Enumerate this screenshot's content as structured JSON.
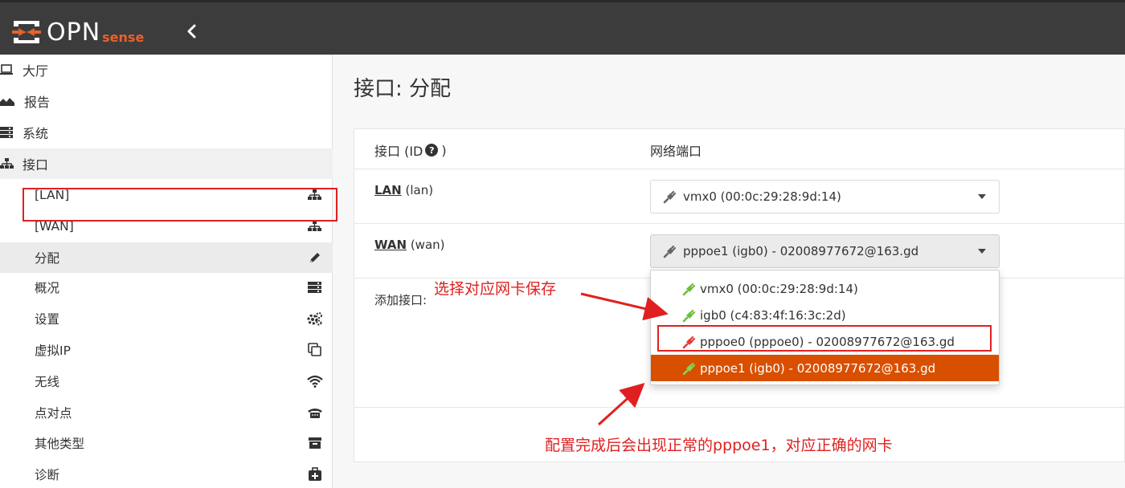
{
  "header": {
    "brand": "OPN",
    "brand_suffix": "sense",
    "collapse_icon": "chevron-left-icon"
  },
  "sidebar": {
    "top_items": [
      {
        "label": "大厅",
        "icon": "laptop-icon"
      },
      {
        "label": "报告",
        "icon": "area-chart-icon"
      },
      {
        "label": "系统",
        "icon": "server-icon"
      },
      {
        "label": "接口",
        "icon": "sitemap-icon"
      }
    ],
    "interface_items": [
      {
        "label": "[LAN]",
        "icon": "sitemap-icon"
      },
      {
        "label": "[WAN]",
        "icon": "sitemap-icon"
      },
      {
        "label": "分配",
        "icon": "pencil-icon",
        "active": true
      },
      {
        "label": "概况",
        "icon": "server-icon"
      },
      {
        "label": "设置",
        "icon": "cogs-icon"
      },
      {
        "label": "虚拟IP",
        "icon": "clone-icon"
      },
      {
        "label": "无线",
        "icon": "wifi-icon"
      },
      {
        "label": "点对点",
        "icon": "phone-icon"
      },
      {
        "label": "其他类型",
        "icon": "archive-icon"
      },
      {
        "label": "诊断",
        "icon": "medkit-icon"
      }
    ]
  },
  "main": {
    "title": "接口: 分配",
    "table": {
      "col_interface": "接口 (ID",
      "col_interface_close": ")",
      "col_port": "网络端口",
      "rows": [
        {
          "name": "LAN",
          "id": "(lan)",
          "value": "vmx0 (00:0c:29:28:9d:14)"
        },
        {
          "name": "WAN",
          "id": "(wan)",
          "value": "pppoe1 (igb0) - 02008977672@163.gd"
        }
      ],
      "add_label": "添加接口:"
    },
    "dropdown_options": [
      {
        "label": "vmx0 (00:0c:29:28:9d:14)",
        "status": "green"
      },
      {
        "label": "igb0 (c4:83:4f:16:3c:2d)",
        "status": "green"
      },
      {
        "label": "pppoe0 (pppoe0) - 02008977672@163.gd",
        "status": "red"
      },
      {
        "label": "pppoe1 (igb0) - 02008977672@163.gd",
        "status": "green",
        "selected": true
      }
    ]
  },
  "annotations": {
    "note1": "选择对应网卡保存",
    "note2": "配置完成后会出现正常的pppoe1，对应正确的网卡"
  },
  "colors": {
    "accent": "#d94f00",
    "annotation": "#e02020",
    "plug_green": "#6abf3a",
    "plug_red": "#e23b3b",
    "topbar": "#3c3c3c"
  }
}
